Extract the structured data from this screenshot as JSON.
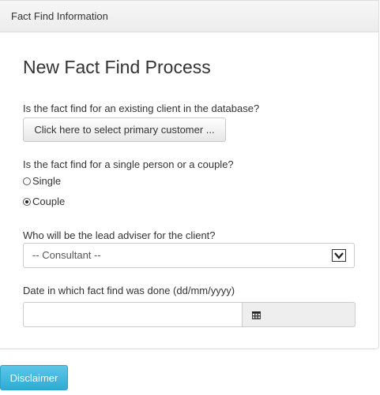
{
  "panel": {
    "heading": "Fact Find Information",
    "title": "New Fact Find Process"
  },
  "existing_client": {
    "question": "Is the fact find for an existing client in the database?",
    "button_label": "Click here to select primary customer ..."
  },
  "person_type": {
    "question": "Is the fact find for a single person or a couple?",
    "options": [
      {
        "label": "Single",
        "selected": false
      },
      {
        "label": "Couple",
        "selected": true
      }
    ]
  },
  "lead_adviser": {
    "question": "Who will be the lead adviser for the client?",
    "selected_value": "-- Consultant --"
  },
  "date_done": {
    "label": "Date in which fact find was done (dd/mm/yyyy)",
    "value": "",
    "icon": "calendar-icon"
  },
  "footer": {
    "disclaimer_label": "Disclaimer"
  },
  "colors": {
    "info_button": "#31b0d5",
    "heading_bg": "#f2f2f2"
  }
}
